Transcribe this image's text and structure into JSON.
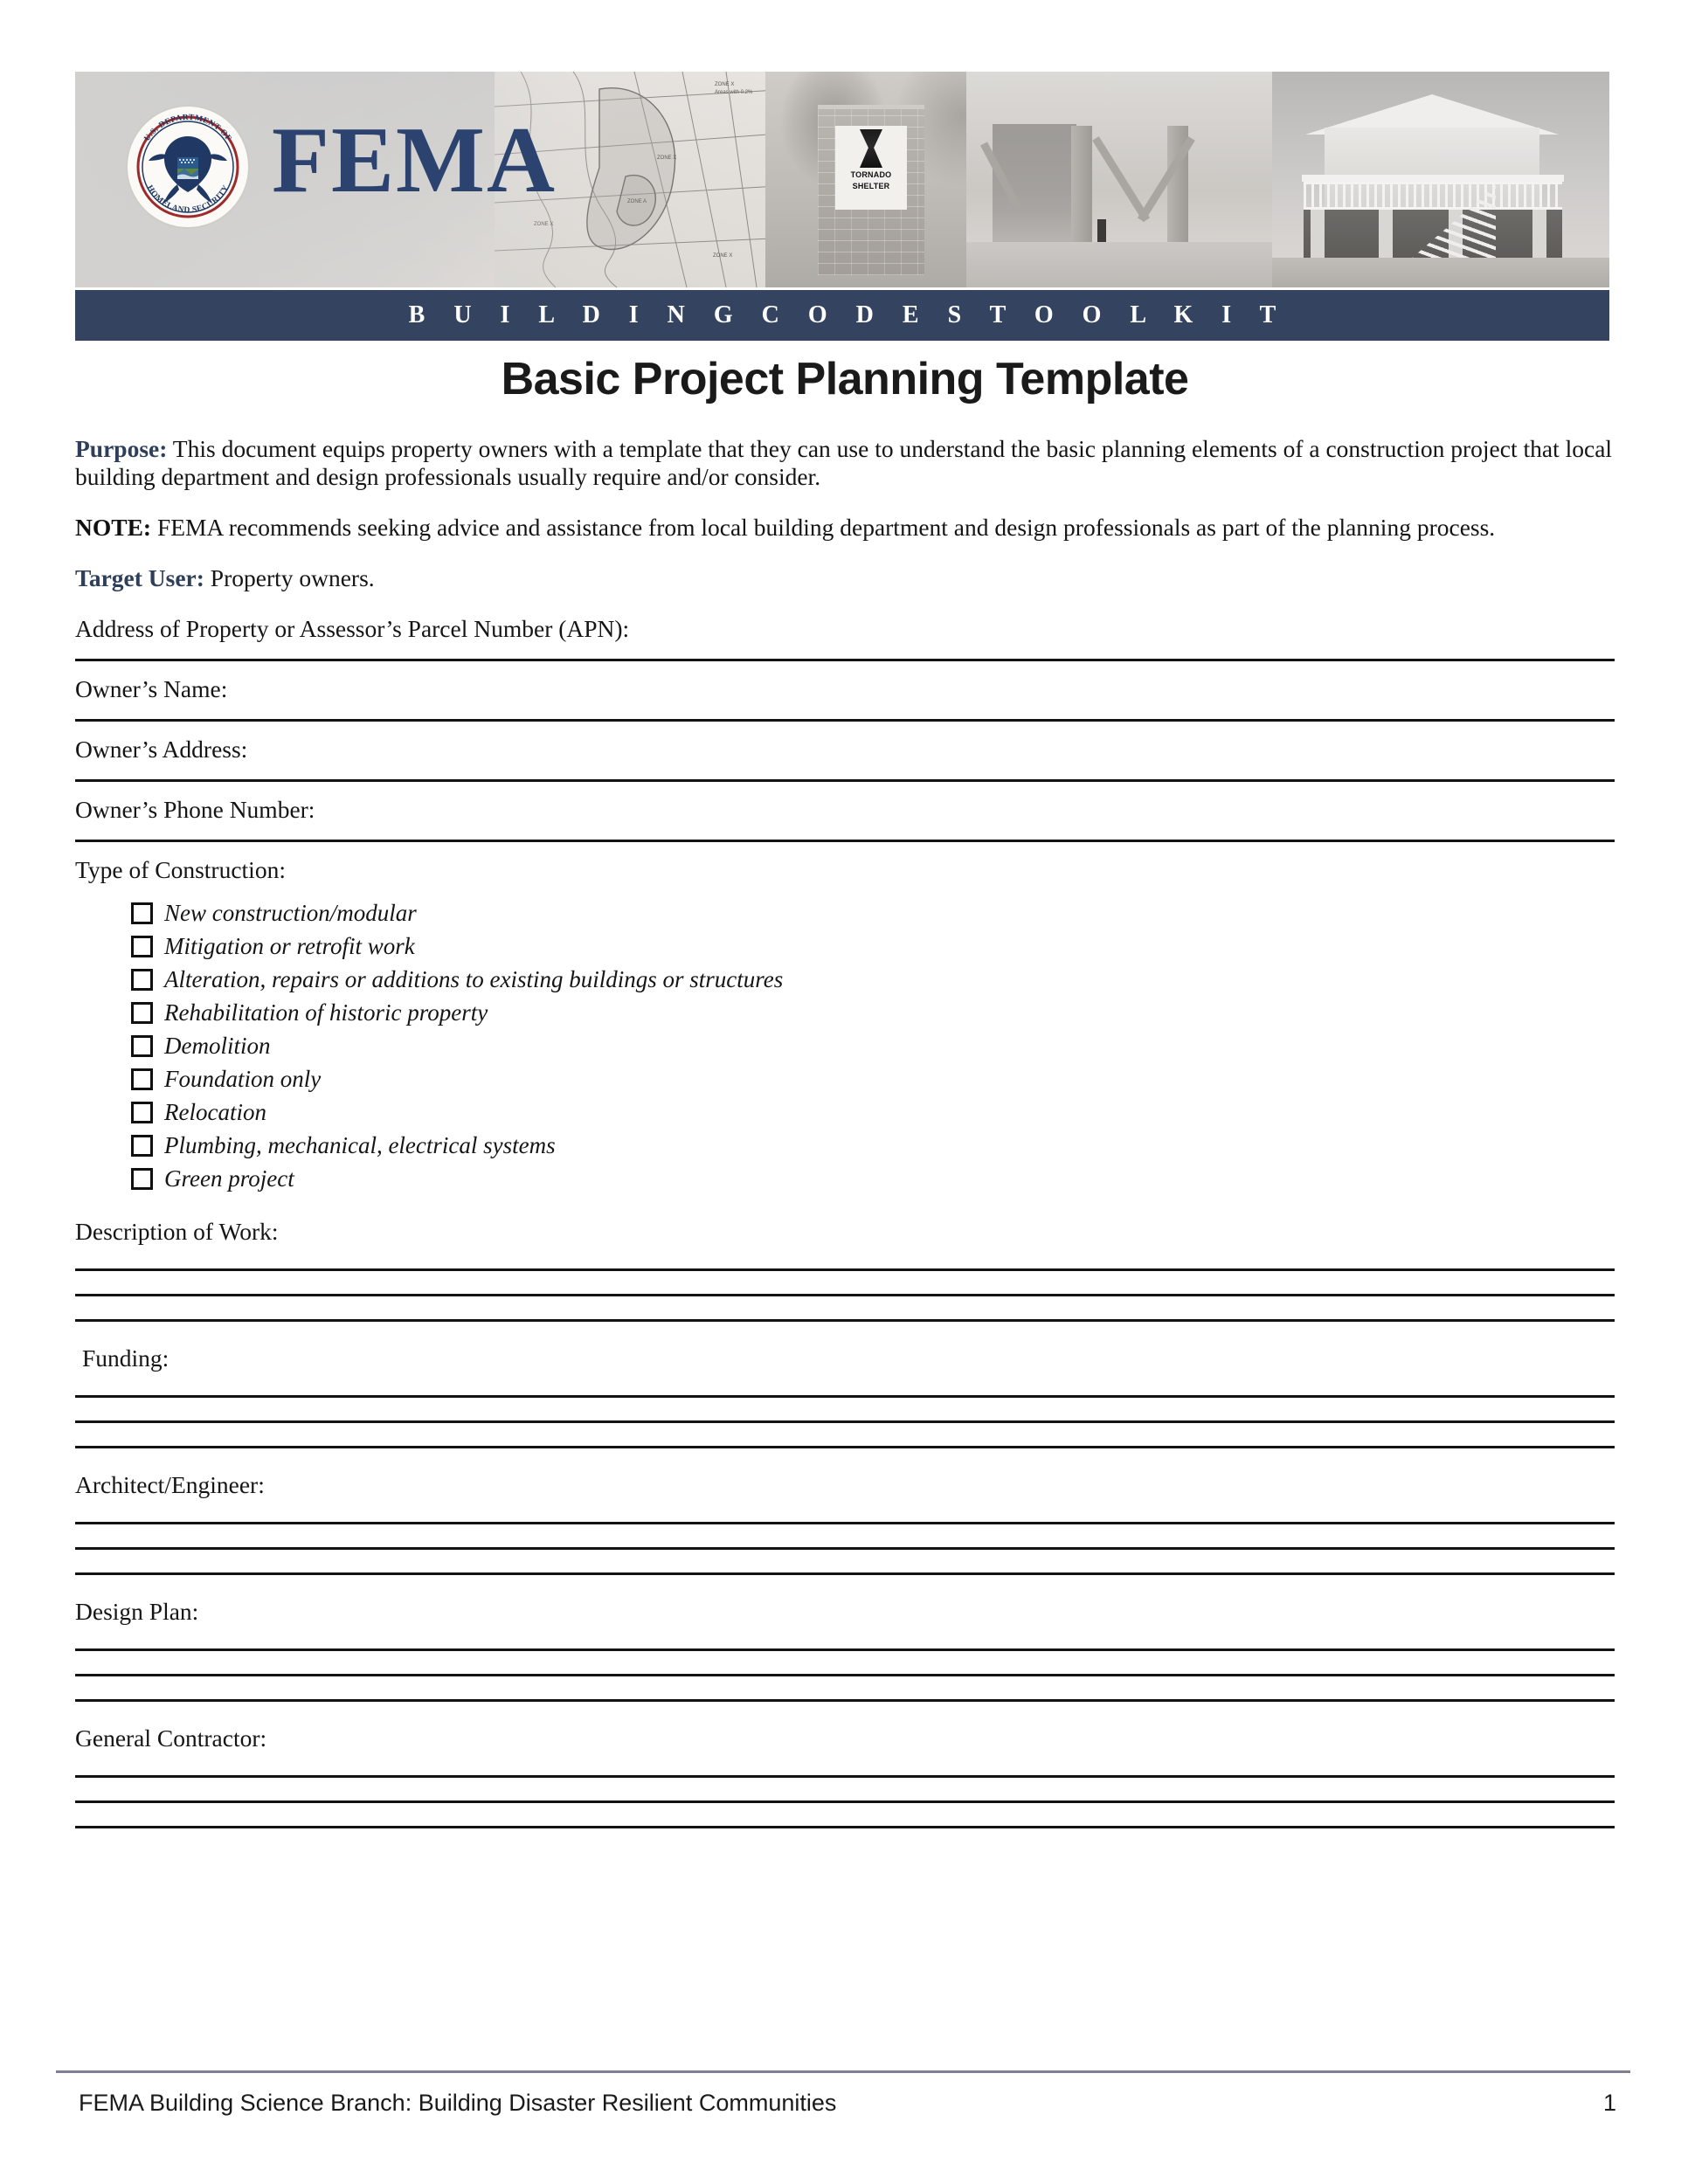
{
  "header": {
    "agency_abbr": "FEMA",
    "seal_text_top": "U.S. DEPARTMENT OF",
    "seal_text_bottom": "HOMELAND SECURITY",
    "toolkit_bar": "B U I L D I N G   C O D E S   T O O L K I T",
    "shelter_sign_line1": "TORNADO",
    "shelter_sign_line2": "SHELTER",
    "brand_blue": "#2c4370",
    "bar_blue": "#344360"
  },
  "document": {
    "title": "Basic Project Planning Template",
    "paragraphs": [
      {
        "lead": "Purpose:",
        "lead_style": "blue",
        "text": " This document equips property owners with a template that they can use to understand the basic planning elements of a construction project that local building department and design professionals usually require and/or consider."
      },
      {
        "lead": "NOTE:",
        "lead_style": "black",
        "text": " FEMA recommends seeking advice and assistance from local building department and design professionals as part of the planning process."
      },
      {
        "lead": "Target User:",
        "lead_style": "blue",
        "text": " Property owners."
      }
    ],
    "fields": [
      {
        "label": "Address of Property or Assessor’s Parcel Number (APN):",
        "lines": 1
      },
      {
        "label": "Owner’s Name:",
        "lines": 1
      },
      {
        "label": "Owner’s Address:",
        "lines": 1
      },
      {
        "label": "Owner’s Phone Number:",
        "lines": 1
      }
    ],
    "construction_type": {
      "label": "Type of Construction:",
      "options": [
        "New construction/modular",
        "Mitigation or retrofit work",
        "Alteration, repairs or additions to existing buildings or structures",
        "Rehabilitation of historic property",
        "Demolition",
        "Foundation only",
        "Relocation",
        "Plumbing, mechanical, electrical systems",
        "Green project"
      ]
    },
    "long_fields": [
      {
        "label": "Description of Work:",
        "lines": 3,
        "indent": false
      },
      {
        "label": " Funding:",
        "lines": 3,
        "indent": true
      },
      {
        "label": "Architect/Engineer:",
        "lines": 3,
        "indent": false
      },
      {
        "label": "Design Plan:",
        "lines": 3,
        "indent": false
      },
      {
        "label": "General Contractor:",
        "lines": 3,
        "indent": false
      }
    ]
  },
  "footer": {
    "text": "FEMA Building Science Branch:  Building Disaster Resilient Communities",
    "page_number": "1"
  }
}
